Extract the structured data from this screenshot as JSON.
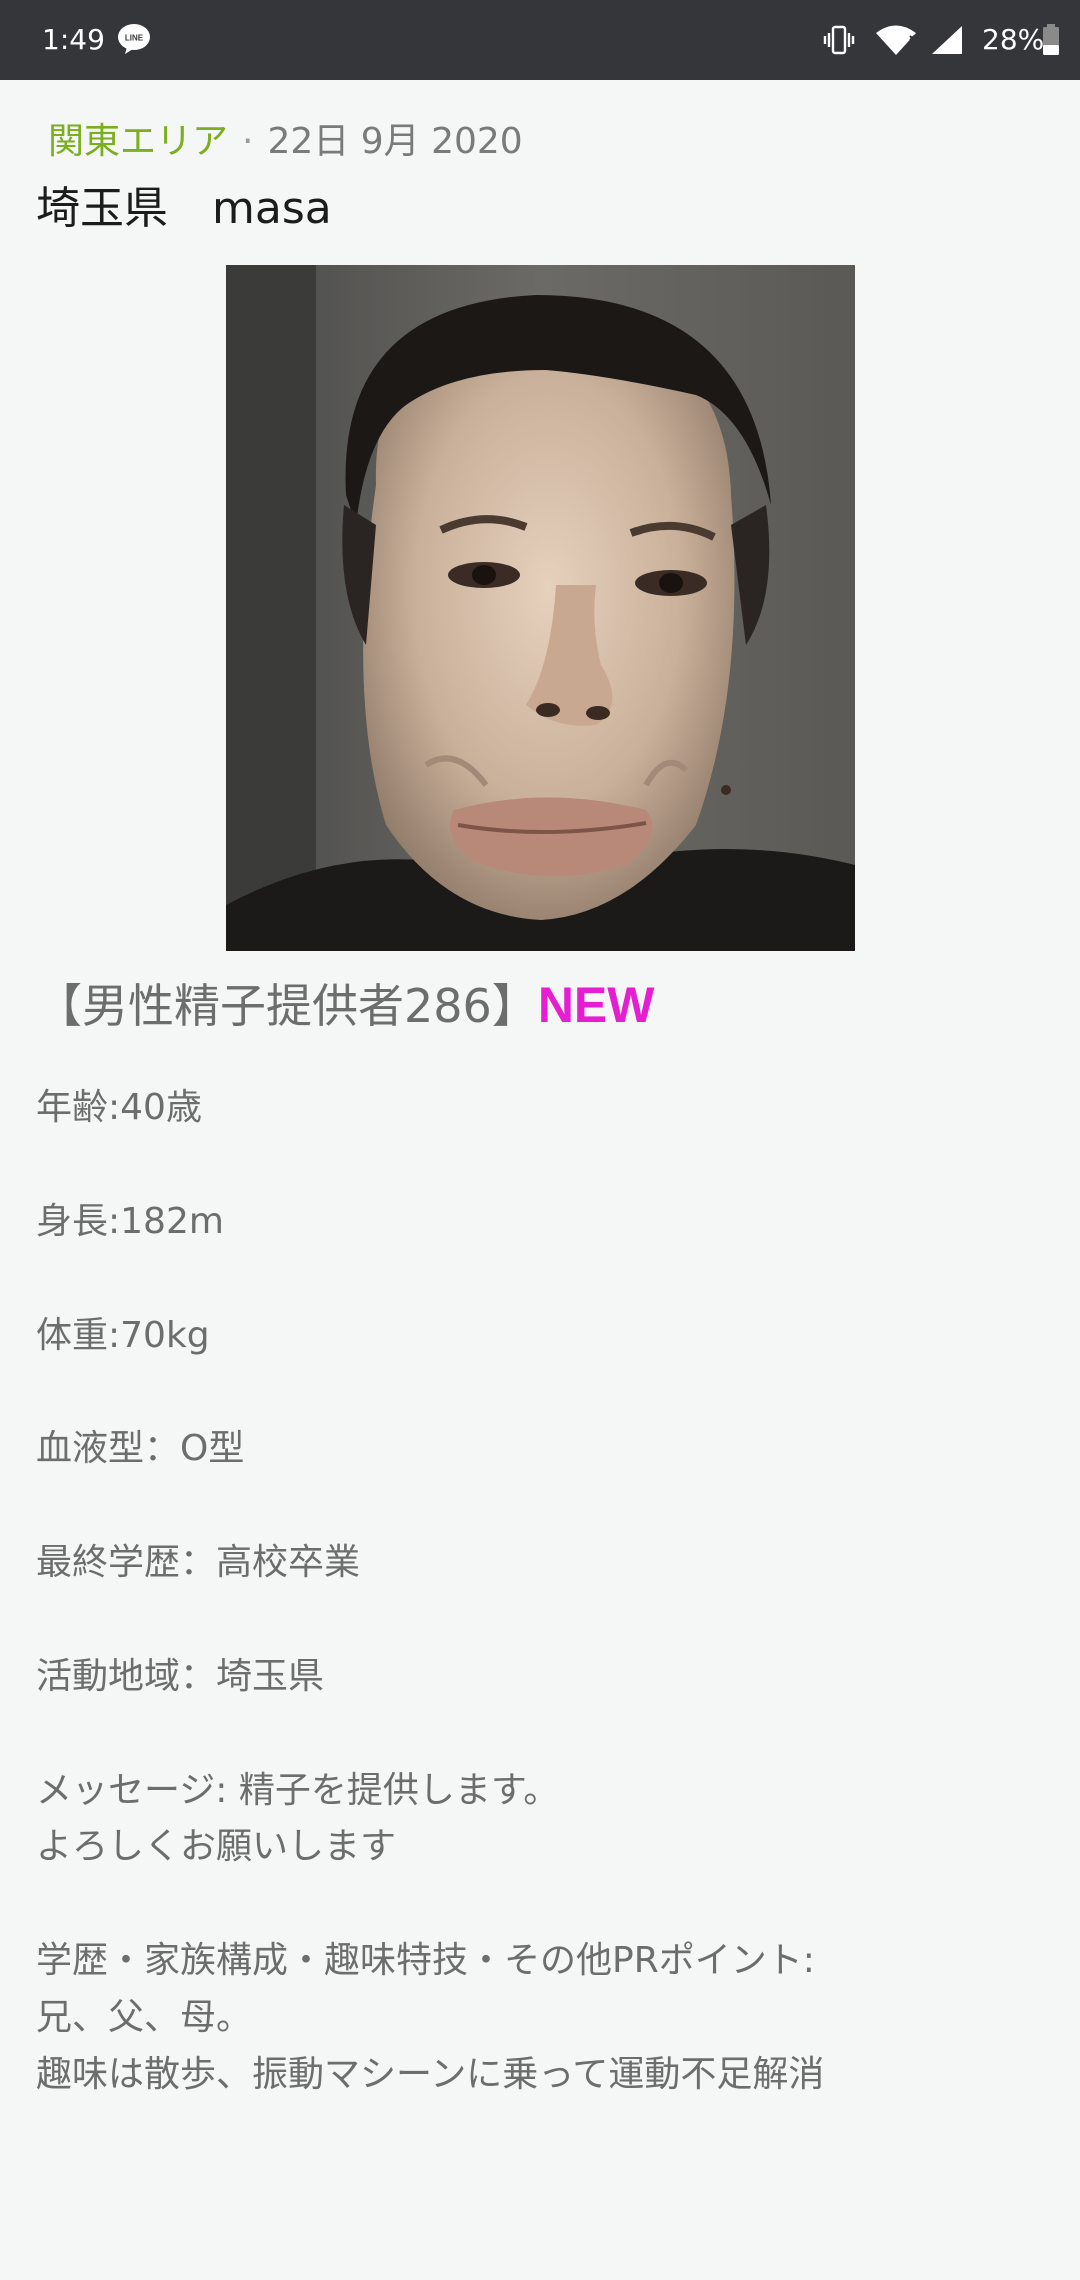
{
  "status_bar": {
    "time": "1:49",
    "app_icon": "line-app-icon",
    "icons": [
      "vibrate-icon",
      "wifi-icon",
      "signal-icon",
      "battery-icon"
    ],
    "battery": "28%"
  },
  "post": {
    "category": "関東エリア",
    "separator": "·",
    "date": "22日 9月 2020",
    "title": "埼玉県　masa",
    "photo_icon": "profile-photo",
    "headline": "【男性精子提供者286】",
    "new_label": "NEW",
    "fields": {
      "age": "年齢:40歳",
      "height": "身長:182m",
      "weight": "体重:70kg",
      "blood": "血液型：O型",
      "education": "最終学歴：高校卒業",
      "area": "活動地域：埼玉県",
      "message_1": "メッセージ:  精子を提供します。",
      "message_2": "よろしくお願いします",
      "pr_1": "学歴・家族構成・趣味特技・その他PRポイント:",
      "pr_2": "兄、父、母。",
      "pr_3": "趣味は散歩、振動マシーンに乗って運動不足解消"
    }
  },
  "colors": {
    "status_bar_bg": "#35363a",
    "page_bg": "#f5f7f6",
    "category": "#7cae1f",
    "new_badge": "#e61ed2",
    "body_text": "#6d6d6d"
  }
}
